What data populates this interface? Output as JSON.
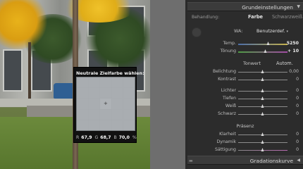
{
  "loupe": {
    "title": "Neutrale Zielfarbe wählen:",
    "r_label": "R",
    "r_value": "67,9",
    "g_label": "G",
    "g_value": "68,7",
    "b_label": "B",
    "b_value": "70,0",
    "unit": "%"
  },
  "panel": {
    "basic_title": "Grundeinstellungen",
    "treatment_label": "Behandlung:",
    "treatment_color": "Farbe",
    "treatment_bw": "Schwarzweiß",
    "wb_label": "WA:",
    "wb_value": "Benutzerdef.",
    "tone_label": "Tonwert",
    "tone_auto": "Autom.",
    "presence_label": "Präsenz",
    "tone_curve_title": "Gradationskurve",
    "sliders": [
      {
        "label": "Temp.",
        "value": "5250",
        "pos": 0.62,
        "emph": true
      },
      {
        "label": "Tönung",
        "value": "+ 10",
        "pos": 0.55,
        "emph": true
      },
      {
        "label": "Belichtung",
        "value": "0,00",
        "pos": 0.5
      },
      {
        "label": "Kontrast",
        "value": "0",
        "pos": 0.5
      },
      {
        "label": "Lichter",
        "value": "0",
        "pos": 0.5
      },
      {
        "label": "Tiefen",
        "value": "0",
        "pos": 0.5
      },
      {
        "label": "Weiß",
        "value": "0",
        "pos": 0.5
      },
      {
        "label": "Schwarz",
        "value": "0",
        "pos": 0.5
      },
      {
        "label": "Klarheit",
        "value": "0",
        "pos": 0.5
      },
      {
        "label": "Dynamik",
        "value": "0",
        "pos": 0.5
      },
      {
        "label": "Sättigung",
        "value": "0",
        "pos": 0.5
      }
    ]
  },
  "colors": {
    "panel_bg": "#2c2c2c",
    "header_bg": "#3b3b3b",
    "gutter": "#6e6e6e"
  }
}
